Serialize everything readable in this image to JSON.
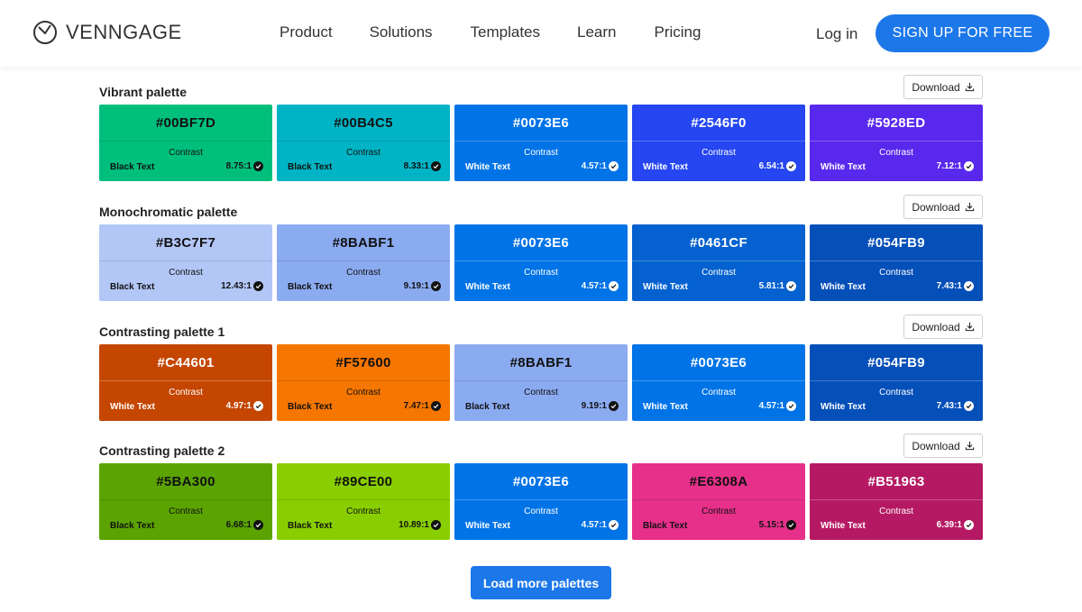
{
  "header": {
    "logo_text": "VENNGAGE",
    "nav": [
      "Product",
      "Solutions",
      "Templates",
      "Learn",
      "Pricing"
    ],
    "login": "Log in",
    "signup": "SIGN UP FOR FREE"
  },
  "common": {
    "contrast_label": "Contrast",
    "download_label": "Download"
  },
  "palettes": [
    {
      "title": "Vibrant palette",
      "swatches": [
        {
          "hex": "#00BF7D",
          "color": "#00BF7D",
          "text_label": "Black Text",
          "ratio": "8.75:1",
          "mode": "dark"
        },
        {
          "hex": "#00B4C5",
          "color": "#00B4C5",
          "text_label": "Black Text",
          "ratio": "8.33:1",
          "mode": "dark"
        },
        {
          "hex": "#0073E6",
          "color": "#0073E6",
          "text_label": "White Text",
          "ratio": "4.57:1",
          "mode": "light"
        },
        {
          "hex": "#2546F0",
          "color": "#2546F0",
          "text_label": "White Text",
          "ratio": "6.54:1",
          "mode": "light"
        },
        {
          "hex": "#5928ED",
          "color": "#5928ED",
          "text_label": "White Text",
          "ratio": "7.12:1",
          "mode": "light"
        }
      ]
    },
    {
      "title": "Monochromatic palette",
      "swatches": [
        {
          "hex": "#B3C7F7",
          "color": "#B3C7F7",
          "text_label": "Black Text",
          "ratio": "12.43:1",
          "mode": "dark"
        },
        {
          "hex": "#8BABF1",
          "color": "#8BABF1",
          "text_label": "Black Text",
          "ratio": "9.19:1",
          "mode": "dark"
        },
        {
          "hex": "#0073E6",
          "color": "#0073E6",
          "text_label": "White Text",
          "ratio": "4.57:1",
          "mode": "light"
        },
        {
          "hex": "#0461CF",
          "color": "#0461CF",
          "text_label": "White Text",
          "ratio": "5.81:1",
          "mode": "light"
        },
        {
          "hex": "#054FB9",
          "color": "#054FB9",
          "text_label": "White Text",
          "ratio": "7.43:1",
          "mode": "light"
        }
      ]
    },
    {
      "title": "Contrasting palette 1",
      "swatches": [
        {
          "hex": "#C44601",
          "color": "#C44601",
          "text_label": "White Text",
          "ratio": "4.97:1",
          "mode": "light"
        },
        {
          "hex": "#F57600",
          "color": "#F57600",
          "text_label": "Black Text",
          "ratio": "7.47:1",
          "mode": "dark"
        },
        {
          "hex": "#8BABF1",
          "color": "#8BABF1",
          "text_label": "Black Text",
          "ratio": "9.19:1",
          "mode": "dark"
        },
        {
          "hex": "#0073E6",
          "color": "#0073E6",
          "text_label": "White Text",
          "ratio": "4.57:1",
          "mode": "light"
        },
        {
          "hex": "#054FB9",
          "color": "#054FB9",
          "text_label": "White Text",
          "ratio": "7.43:1",
          "mode": "light"
        }
      ]
    },
    {
      "title": "Contrasting palette 2",
      "swatches": [
        {
          "hex": "#5BA300",
          "color": "#5BA300",
          "text_label": "Black Text",
          "ratio": "6.68:1",
          "mode": "dark"
        },
        {
          "hex": "#89CE00",
          "color": "#89CE00",
          "text_label": "Black Text",
          "ratio": "10.89:1",
          "mode": "dark"
        },
        {
          "hex": "#0073E6",
          "color": "#0073E6",
          "text_label": "White Text",
          "ratio": "4.57:1",
          "mode": "light"
        },
        {
          "hex": "#E6308A",
          "color": "#E6308A",
          "text_label": "Black Text",
          "ratio": "5.15:1",
          "mode": "dark"
        },
        {
          "hex": "#B51963",
          "color": "#B51963",
          "text_label": "White Text",
          "ratio": "6.39:1",
          "mode": "light"
        }
      ]
    }
  ],
  "load_more": "Load more palettes"
}
